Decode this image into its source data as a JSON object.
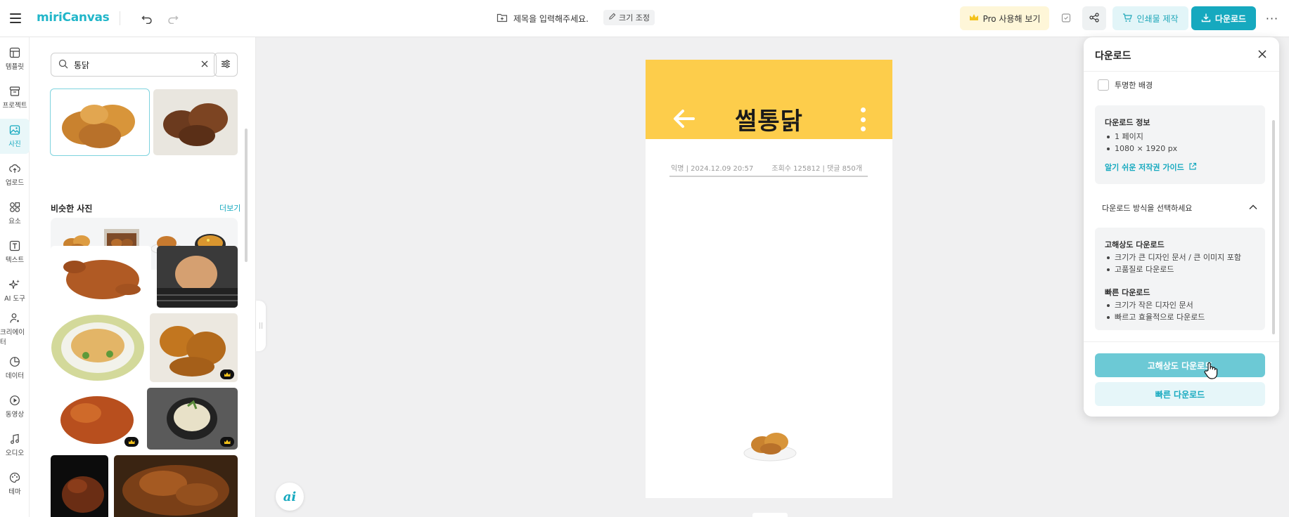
{
  "topbar": {
    "logo": "miriCanvas",
    "doc_title_placeholder": "제목을 입력해주세요.",
    "resize_label": "크기 조정",
    "pro_label": "Pro 사용해 보기",
    "print_label": "인쇄물 제작",
    "download_label": "다운로드",
    "more_label": "···"
  },
  "rail": {
    "items": [
      {
        "label": "템플릿",
        "icon": "template-icon"
      },
      {
        "label": "프로젝트",
        "icon": "folder-icon"
      },
      {
        "label": "사진",
        "icon": "photo-icon"
      },
      {
        "label": "업로드",
        "icon": "upload-icon"
      },
      {
        "label": "요소",
        "icon": "elements-icon"
      },
      {
        "label": "텍스트",
        "icon": "text-icon"
      },
      {
        "label": "AI 도구",
        "icon": "sparkle-icon"
      },
      {
        "label": "크리에이터",
        "icon": "creator-icon"
      },
      {
        "label": "데이터",
        "icon": "chart-icon"
      },
      {
        "label": "동영상",
        "icon": "play-icon"
      },
      {
        "label": "오디오",
        "icon": "music-icon"
      },
      {
        "label": "테마",
        "icon": "palette-icon"
      }
    ],
    "active_index": 2
  },
  "photo_panel": {
    "search_value": "통닭",
    "similar_heading": "비슷한 사진",
    "more_link": "더보기"
  },
  "canvas": {
    "heading": "썰통닭",
    "meta_left": "익명  |  2024.12.09 20:57",
    "meta_right": "조회수 125812  |  댓글 850개",
    "header_color": "#fdcd4b"
  },
  "ai_button": "ai",
  "download_panel": {
    "title": "다운로드",
    "transparent_bg": "투명한 배경",
    "info_title": "다운로드 정보",
    "info_items": [
      "1 페이지",
      "1080 × 1920 px"
    ],
    "guide_link": "알기 쉬운 저작권 가이드",
    "method_label": "다운로드 방식을 선택하세요",
    "hq_title": "고해상도 다운로드",
    "hq_items": [
      "크기가 큰 디자인 문서 / 큰 이미지 포함",
      "고품질로 다운로드"
    ],
    "fast_title": "빠른 다운로드",
    "fast_items": [
      "크기가 작은 디자인 문서",
      "빠르고 효율적으로 다운로드"
    ],
    "hq_button": "고해상도 다운로드",
    "fast_button": "빠른 다운로드"
  },
  "colors": {
    "accent": "#16a9bf",
    "pro_bg": "#fef6d8"
  }
}
